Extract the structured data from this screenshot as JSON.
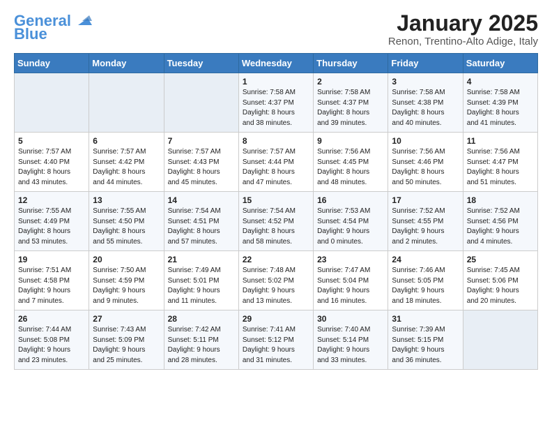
{
  "header": {
    "logo_line1": "General",
    "logo_line2": "Blue",
    "title": "January 2025",
    "subtitle": "Renon, Trentino-Alto Adige, Italy"
  },
  "days_of_week": [
    "Sunday",
    "Monday",
    "Tuesday",
    "Wednesday",
    "Thursday",
    "Friday",
    "Saturday"
  ],
  "weeks": [
    [
      {
        "day": "",
        "info": ""
      },
      {
        "day": "",
        "info": ""
      },
      {
        "day": "",
        "info": ""
      },
      {
        "day": "1",
        "info": "Sunrise: 7:58 AM\nSunset: 4:37 PM\nDaylight: 8 hours\nand 38 minutes."
      },
      {
        "day": "2",
        "info": "Sunrise: 7:58 AM\nSunset: 4:37 PM\nDaylight: 8 hours\nand 39 minutes."
      },
      {
        "day": "3",
        "info": "Sunrise: 7:58 AM\nSunset: 4:38 PM\nDaylight: 8 hours\nand 40 minutes."
      },
      {
        "day": "4",
        "info": "Sunrise: 7:58 AM\nSunset: 4:39 PM\nDaylight: 8 hours\nand 41 minutes."
      }
    ],
    [
      {
        "day": "5",
        "info": "Sunrise: 7:57 AM\nSunset: 4:40 PM\nDaylight: 8 hours\nand 43 minutes."
      },
      {
        "day": "6",
        "info": "Sunrise: 7:57 AM\nSunset: 4:42 PM\nDaylight: 8 hours\nand 44 minutes."
      },
      {
        "day": "7",
        "info": "Sunrise: 7:57 AM\nSunset: 4:43 PM\nDaylight: 8 hours\nand 45 minutes."
      },
      {
        "day": "8",
        "info": "Sunrise: 7:57 AM\nSunset: 4:44 PM\nDaylight: 8 hours\nand 47 minutes."
      },
      {
        "day": "9",
        "info": "Sunrise: 7:56 AM\nSunset: 4:45 PM\nDaylight: 8 hours\nand 48 minutes."
      },
      {
        "day": "10",
        "info": "Sunrise: 7:56 AM\nSunset: 4:46 PM\nDaylight: 8 hours\nand 50 minutes."
      },
      {
        "day": "11",
        "info": "Sunrise: 7:56 AM\nSunset: 4:47 PM\nDaylight: 8 hours\nand 51 minutes."
      }
    ],
    [
      {
        "day": "12",
        "info": "Sunrise: 7:55 AM\nSunset: 4:49 PM\nDaylight: 8 hours\nand 53 minutes."
      },
      {
        "day": "13",
        "info": "Sunrise: 7:55 AM\nSunset: 4:50 PM\nDaylight: 8 hours\nand 55 minutes."
      },
      {
        "day": "14",
        "info": "Sunrise: 7:54 AM\nSunset: 4:51 PM\nDaylight: 8 hours\nand 57 minutes."
      },
      {
        "day": "15",
        "info": "Sunrise: 7:54 AM\nSunset: 4:52 PM\nDaylight: 8 hours\nand 58 minutes."
      },
      {
        "day": "16",
        "info": "Sunrise: 7:53 AM\nSunset: 4:54 PM\nDaylight: 9 hours\nand 0 minutes."
      },
      {
        "day": "17",
        "info": "Sunrise: 7:52 AM\nSunset: 4:55 PM\nDaylight: 9 hours\nand 2 minutes."
      },
      {
        "day": "18",
        "info": "Sunrise: 7:52 AM\nSunset: 4:56 PM\nDaylight: 9 hours\nand 4 minutes."
      }
    ],
    [
      {
        "day": "19",
        "info": "Sunrise: 7:51 AM\nSunset: 4:58 PM\nDaylight: 9 hours\nand 7 minutes."
      },
      {
        "day": "20",
        "info": "Sunrise: 7:50 AM\nSunset: 4:59 PM\nDaylight: 9 hours\nand 9 minutes."
      },
      {
        "day": "21",
        "info": "Sunrise: 7:49 AM\nSunset: 5:01 PM\nDaylight: 9 hours\nand 11 minutes."
      },
      {
        "day": "22",
        "info": "Sunrise: 7:48 AM\nSunset: 5:02 PM\nDaylight: 9 hours\nand 13 minutes."
      },
      {
        "day": "23",
        "info": "Sunrise: 7:47 AM\nSunset: 5:04 PM\nDaylight: 9 hours\nand 16 minutes."
      },
      {
        "day": "24",
        "info": "Sunrise: 7:46 AM\nSunset: 5:05 PM\nDaylight: 9 hours\nand 18 minutes."
      },
      {
        "day": "25",
        "info": "Sunrise: 7:45 AM\nSunset: 5:06 PM\nDaylight: 9 hours\nand 20 minutes."
      }
    ],
    [
      {
        "day": "26",
        "info": "Sunrise: 7:44 AM\nSunset: 5:08 PM\nDaylight: 9 hours\nand 23 minutes."
      },
      {
        "day": "27",
        "info": "Sunrise: 7:43 AM\nSunset: 5:09 PM\nDaylight: 9 hours\nand 25 minutes."
      },
      {
        "day": "28",
        "info": "Sunrise: 7:42 AM\nSunset: 5:11 PM\nDaylight: 9 hours\nand 28 minutes."
      },
      {
        "day": "29",
        "info": "Sunrise: 7:41 AM\nSunset: 5:12 PM\nDaylight: 9 hours\nand 31 minutes."
      },
      {
        "day": "30",
        "info": "Sunrise: 7:40 AM\nSunset: 5:14 PM\nDaylight: 9 hours\nand 33 minutes."
      },
      {
        "day": "31",
        "info": "Sunrise: 7:39 AM\nSunset: 5:15 PM\nDaylight: 9 hours\nand 36 minutes."
      },
      {
        "day": "",
        "info": ""
      }
    ]
  ]
}
